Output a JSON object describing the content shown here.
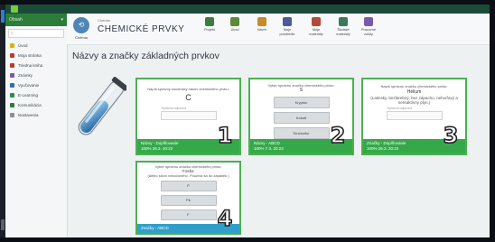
{
  "app": {
    "sidebar_dropdown": "Obsah",
    "breadcrumb": "",
    "page_title": "Názvy a značky základných prvkov"
  },
  "sidebar": {
    "items": [
      {
        "label": "Úvod",
        "icon": "star-icon",
        "color": "#e0b000"
      },
      {
        "label": "Moja stránka",
        "icon": "home-icon",
        "color": "#c0392b"
      },
      {
        "label": "Triedna kniha",
        "icon": "book-icon",
        "color": "#c0392b"
      },
      {
        "label": "Známky",
        "icon": "grades-icon",
        "color": "#7a5aa8"
      },
      {
        "label": "Vyučovanie",
        "icon": "teaching-icon",
        "color": "#2f6fb2"
      },
      {
        "label": "E-Learning",
        "icon": "elearning-icon",
        "color": "#2e8b57"
      },
      {
        "label": "Komunikácia",
        "icon": "chat-icon",
        "color": "#2c7d3a"
      },
      {
        "label": "Nastavenia",
        "icon": "settings-icon",
        "color": "#8a8f93"
      }
    ]
  },
  "header": {
    "logo_caption": "Chémia",
    "subtitle": "Chémia",
    "title": "CHEMICKÉ PRVKY",
    "tools": [
      {
        "label": "Projekt",
        "icon": "person-icon",
        "color": "#3b7d3f"
      },
      {
        "label": "Úvod",
        "icon": "people-icon",
        "color": "#5a8a3a"
      },
      {
        "label": "Návrh",
        "icon": "folder-icon",
        "color": "#c98a2a"
      },
      {
        "label": "Moje prostredie",
        "icon": "user-icon",
        "color": "#4a5a9a"
      },
      {
        "label": "Moje materiály",
        "icon": "materials-icon",
        "color": "#b44a3a"
      },
      {
        "label": "Školské materiály",
        "icon": "school-icon",
        "color": "#3a7a5a"
      },
      {
        "label": "Pracovné zošity",
        "icon": "workbook-icon",
        "color": "#7a5aa8"
      }
    ]
  },
  "cards": [
    {
      "question": "Napíš správny slovenský názov chemického prvku:",
      "symbol": "C",
      "input_label": "Správna odpoveď",
      "options": [],
      "footer_line1": "Názvy - Doplňovanie",
      "footer_line2": "100%  26.3. 20:22",
      "number": "1"
    },
    {
      "question": "Vyber správnu značku chemického prvku:",
      "symbol": "S",
      "input_label": "",
      "options": [
        "Kryptón",
        "Kobalt",
        "Síra/sulfur"
      ],
      "footer_line1": "Názvy - ABCD",
      "footer_line2": "100%  7.3. 20:23",
      "number": "2"
    },
    {
      "question": "Napíš správnu značku chemického prvku:",
      "symbol": "Hélium",
      "note": "(Latinsky, bezfarebný, bez zápachu, nehorľavý a nereaktívny plyn.)",
      "input_label": "Správna odpoveď",
      "options": [],
      "footer_line1": "Značky - Doplňovanie",
      "footer_line2": "100%  26.3. 20:22",
      "number": "3"
    },
    {
      "question": "Vyber správnu značku chemického prvku:",
      "symbol": "Fosfor",
      "note": "(alebo slovo nekovového. Používa sa do zápaliek.)",
      "input_label": "",
      "options": [
        "P",
        "Pb",
        "F"
      ],
      "footer_line1": "Značky - ABCD",
      "footer_line2": "",
      "number": "4"
    }
  ],
  "colors": {
    "accent_green": "#35a94a",
    "card_border": "#4caf50",
    "sidebar_header": "#2c7d3a"
  }
}
